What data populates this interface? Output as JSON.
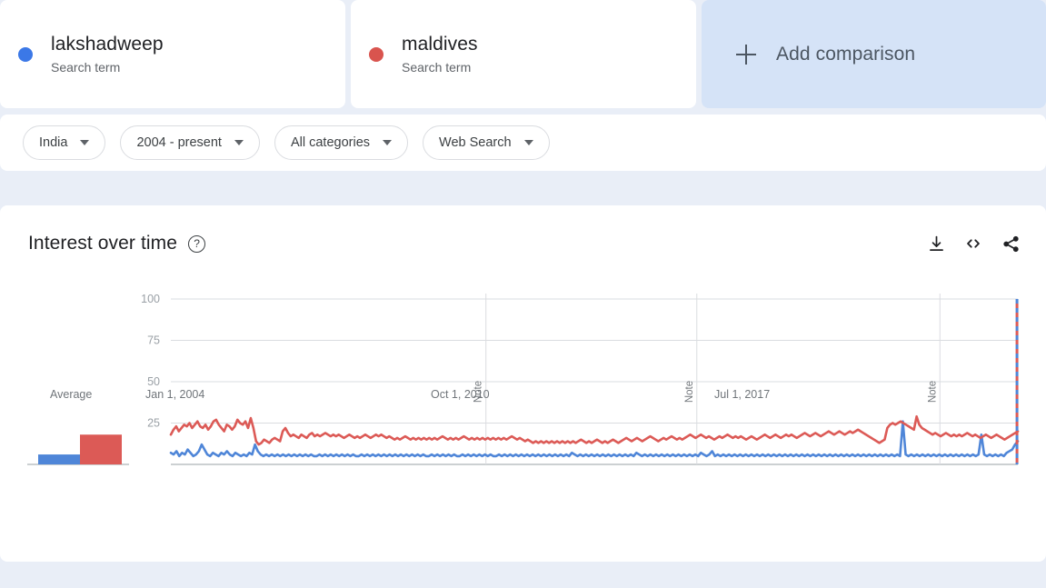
{
  "colors": {
    "series_blue": "#4f86d8",
    "series_red": "#dc5a56",
    "dot_blue": "#3b78e7",
    "dot_red": "#d9544e",
    "page_bg": "#e9eef7",
    "card_bg": "#ffffff",
    "add_comparison_bg": "#d5e3f7",
    "grid": "#dadce0",
    "muted_text": "#70757a"
  },
  "terms": [
    {
      "name": "lakshadweep",
      "type": "Search term",
      "dot_color": "#3b78e7",
      "dot_icon": "series-dot-icon"
    },
    {
      "name": "maldives",
      "type": "Search term",
      "dot_color": "#d9544e",
      "dot_icon": "series-dot-icon"
    }
  ],
  "add_comparison": {
    "label": "Add comparison",
    "icon": "plus-icon"
  },
  "filters": [
    {
      "label": "India",
      "icon": "chevron-down-icon"
    },
    {
      "label": "2004 - present",
      "icon": "chevron-down-icon"
    },
    {
      "label": "All categories",
      "icon": "chevron-down-icon"
    },
    {
      "label": "Web Search",
      "icon": "chevron-down-icon"
    }
  ],
  "chart_panel": {
    "title": "Interest over time",
    "help_icon": "help-circle-icon",
    "help_glyph": "?",
    "actions": [
      {
        "name": "download-button",
        "icon": "download-icon",
        "label": "Download"
      },
      {
        "name": "embed-button",
        "icon": "embed-code-icon",
        "label": "Embed"
      },
      {
        "name": "share-button",
        "icon": "share-icon",
        "label": "Share"
      }
    ]
  },
  "average_widget": {
    "label": "Average",
    "bars": [
      {
        "series": "lakshadweep",
        "color": "#4f86d8",
        "value": 6
      },
      {
        "series": "maldives",
        "color": "#dc5a56",
        "value": 18
      }
    ]
  },
  "chart_data": {
    "type": "line",
    "title": "Interest over time",
    "xlabel": "",
    "ylabel": "",
    "ylim": [
      0,
      100
    ],
    "yticks": [
      100,
      75,
      50,
      25
    ],
    "grid": true,
    "legend_position": "top",
    "x_tick_labels": [
      "Jan 1, 2004",
      "Oct 1, 2010",
      "Jul 1, 2017"
    ],
    "x_tick_fractions": [
      0.0,
      0.353,
      0.688
    ],
    "annotations": [
      {
        "label": "Note",
        "x_fraction": 0.372,
        "orientation": "vertical"
      },
      {
        "label": "Note",
        "x_fraction": 0.621,
        "orientation": "vertical"
      },
      {
        "label": "Note",
        "x_fraction": 0.908,
        "orientation": "vertical"
      }
    ],
    "partial_data_marker": {
      "x_fraction": 0.999,
      "style": "dashed",
      "colors": [
        "#4f86d8",
        "#dc5a56"
      ]
    },
    "series": [
      {
        "name": "lakshadweep",
        "color": "#4f86d8",
        "values": [
          7,
          6,
          8,
          5,
          7,
          6,
          9,
          7,
          5,
          6,
          8,
          12,
          9,
          6,
          5,
          7,
          6,
          5,
          7,
          6,
          8,
          6,
          5,
          7,
          6,
          5,
          6,
          5,
          7,
          6,
          12,
          8,
          6,
          5,
          6,
          5,
          6,
          5,
          6,
          5,
          6,
          5,
          6,
          5,
          6,
          5,
          6,
          5,
          6,
          5,
          6,
          5,
          5,
          6,
          5,
          6,
          5,
          6,
          5,
          6,
          5,
          6,
          5,
          6,
          5,
          6,
          5,
          5,
          6,
          5,
          6,
          5,
          6,
          5,
          6,
          5,
          6,
          5,
          6,
          5,
          6,
          5,
          6,
          5,
          6,
          5,
          6,
          5,
          6,
          5,
          6,
          5,
          5,
          6,
          5,
          6,
          5,
          6,
          5,
          6,
          5,
          6,
          5,
          5,
          6,
          5,
          6,
          5,
          6,
          5,
          6,
          5,
          6,
          5,
          6,
          5,
          5,
          6,
          5,
          6,
          5,
          6,
          5,
          6,
          5,
          6,
          5,
          6,
          5,
          6,
          5,
          6,
          5,
          6,
          5,
          6,
          5,
          6,
          5,
          6,
          5,
          6,
          5,
          7,
          6,
          5,
          6,
          5,
          6,
          5,
          6,
          5,
          6,
          5,
          6,
          5,
          6,
          5,
          6,
          5,
          6,
          5,
          6,
          5,
          6,
          5,
          7,
          6,
          5,
          6,
          5,
          6,
          5,
          6,
          5,
          6,
          5,
          6,
          5,
          6,
          5,
          6,
          5,
          6,
          5,
          6,
          5,
          6,
          5,
          7,
          6,
          5,
          6,
          8,
          5,
          6,
          5,
          6,
          5,
          6,
          5,
          6,
          5,
          6,
          5,
          6,
          5,
          6,
          5,
          6,
          5,
          6,
          5,
          6,
          5,
          6,
          5,
          6,
          5,
          6,
          5,
          6,
          5,
          6,
          5,
          6,
          5,
          6,
          5,
          6,
          5,
          6,
          5,
          6,
          5,
          6,
          5,
          6,
          5,
          6,
          5,
          6,
          5,
          6,
          5,
          6,
          5,
          6,
          5,
          6,
          5,
          6,
          5,
          6,
          5,
          6,
          5,
          6,
          5,
          6,
          5,
          26,
          6,
          5,
          6,
          5,
          6,
          5,
          6,
          5,
          6,
          5,
          6,
          5,
          6,
          5,
          6,
          5,
          6,
          5,
          6,
          5,
          6,
          5,
          6,
          5,
          6,
          5,
          6,
          18,
          6,
          5,
          6,
          5,
          6,
          5,
          6,
          5,
          7,
          8,
          9,
          12,
          14
        ],
        "average": 6
      },
      {
        "name": "maldives",
        "color": "#dc5a56",
        "values": [
          18,
          21,
          23,
          20,
          22,
          24,
          23,
          25,
          22,
          24,
          26,
          23,
          22,
          24,
          21,
          23,
          26,
          27,
          24,
          22,
          20,
          24,
          23,
          21,
          23,
          27,
          25,
          24,
          26,
          22,
          28,
          22,
          14,
          12,
          13,
          15,
          14,
          13,
          15,
          16,
          15,
          14,
          20,
          22,
          19,
          17,
          18,
          17,
          16,
          18,
          17,
          16,
          18,
          19,
          17,
          18,
          17,
          18,
          19,
          18,
          17,
          18,
          17,
          18,
          17,
          16,
          17,
          18,
          17,
          16,
          17,
          16,
          17,
          18,
          17,
          16,
          17,
          18,
          17,
          18,
          17,
          16,
          17,
          16,
          15,
          16,
          15,
          16,
          17,
          16,
          15,
          16,
          15,
          16,
          15,
          16,
          15,
          16,
          15,
          16,
          15,
          16,
          17,
          16,
          15,
          16,
          15,
          16,
          15,
          16,
          17,
          16,
          15,
          16,
          15,
          16,
          15,
          16,
          15,
          16,
          15,
          16,
          15,
          16,
          15,
          16,
          15,
          16,
          17,
          16,
          15,
          16,
          15,
          14,
          15,
          14,
          13,
          14,
          13,
          14,
          13,
          14,
          13,
          14,
          13,
          14,
          13,
          14,
          13,
          14,
          13,
          14,
          13,
          14,
          15,
          14,
          13,
          14,
          13,
          14,
          15,
          14,
          13,
          14,
          13,
          14,
          15,
          14,
          13,
          14,
          15,
          16,
          15,
          14,
          15,
          16,
          15,
          14,
          15,
          16,
          17,
          16,
          15,
          14,
          15,
          16,
          15,
          16,
          17,
          16,
          15,
          16,
          15,
          16,
          17,
          18,
          17,
          16,
          17,
          18,
          17,
          16,
          17,
          16,
          15,
          16,
          17,
          16,
          17,
          18,
          17,
          16,
          17,
          16,
          17,
          16,
          15,
          16,
          17,
          16,
          15,
          16,
          17,
          18,
          17,
          16,
          17,
          18,
          17,
          16,
          17,
          18,
          17,
          18,
          17,
          16,
          17,
          18,
          19,
          18,
          17,
          18,
          19,
          18,
          17,
          18,
          19,
          20,
          19,
          18,
          19,
          20,
          19,
          18,
          19,
          20,
          19,
          20,
          21,
          20,
          19,
          18,
          17,
          16,
          15,
          14,
          13,
          14,
          15,
          22,
          24,
          25,
          24,
          25,
          26,
          25,
          24,
          23,
          22,
          21,
          29,
          24,
          22,
          21,
          20,
          19,
          18,
          19,
          18,
          17,
          18,
          19,
          18,
          17,
          18,
          17,
          18,
          17,
          18,
          19,
          18,
          17,
          18,
          17,
          16,
          17,
          18,
          17,
          16,
          17,
          18,
          17,
          16,
          15,
          16,
          17,
          18,
          19,
          20
        ],
        "average": 18
      }
    ]
  }
}
